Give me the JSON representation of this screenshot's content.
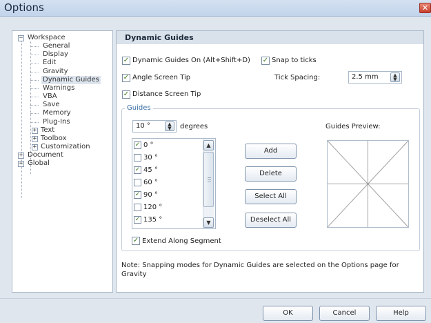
{
  "window": {
    "title": "Options",
    "close_symbol": "✕"
  },
  "tree": {
    "items": [
      {
        "label": "Workspace",
        "level": 0,
        "expander": "−"
      },
      {
        "label": "General",
        "level": 1
      },
      {
        "label": "Display",
        "level": 1
      },
      {
        "label": "Edit",
        "level": 1
      },
      {
        "label": "Gravity",
        "level": 1
      },
      {
        "label": "Dynamic Guides",
        "level": 1,
        "selected": true
      },
      {
        "label": "Warnings",
        "level": 1
      },
      {
        "label": "VBA",
        "level": 1
      },
      {
        "label": "Save",
        "level": 1
      },
      {
        "label": "Memory",
        "level": 1
      },
      {
        "label": "Plug-Ins",
        "level": 1
      },
      {
        "label": "Text",
        "level": 1,
        "expander": "+"
      },
      {
        "label": "Toolbox",
        "level": 1,
        "expander": "+"
      },
      {
        "label": "Customization",
        "level": 1,
        "expander": "+"
      },
      {
        "label": "Document",
        "level": 0,
        "expander": "+"
      },
      {
        "label": "Global",
        "level": 0,
        "expander": "+"
      }
    ]
  },
  "panel": {
    "title": "Dynamic Guides",
    "dynamic_guides_on": {
      "label": "Dynamic Guides On (Alt+Shift+D)",
      "checked": true
    },
    "snap_to_ticks": {
      "label": "Snap to ticks",
      "checked": true
    },
    "angle_screen_tip": {
      "label": "Angle Screen Tip",
      "checked": true
    },
    "distance_screen_tip": {
      "label": "Distance Screen Tip",
      "checked": true
    },
    "tick_spacing": {
      "label": "Tick Spacing:",
      "value": "2.5 mm"
    },
    "guides": {
      "legend": "Guides",
      "angle_value": "10 °",
      "angle_unit": "degrees",
      "angles": [
        {
          "label": "0 °",
          "checked": true
        },
        {
          "label": "30 °",
          "checked": false
        },
        {
          "label": "45 °",
          "checked": true
        },
        {
          "label": "60 °",
          "checked": false
        },
        {
          "label": "90 °",
          "checked": true
        },
        {
          "label": "120 °",
          "checked": false
        },
        {
          "label": "135 °",
          "checked": true
        }
      ],
      "buttons": {
        "add": "Add",
        "delete": "Delete",
        "select_all": "Select All",
        "deselect_all": "Deselect All"
      },
      "preview_label": "Guides Preview:",
      "extend_along_segment": {
        "label": "Extend Along Segment",
        "checked": true
      }
    },
    "note": "Note: Snapping modes for Dynamic Guides are selected on the Options page for Gravity"
  },
  "footer": {
    "ok": "OK",
    "cancel": "Cancel",
    "help": "Help"
  },
  "symbols": {
    "check": "✓",
    "spin_up": "▲",
    "spin_down": "▼",
    "scroll_up": "▲",
    "scroll_down": "▼"
  }
}
